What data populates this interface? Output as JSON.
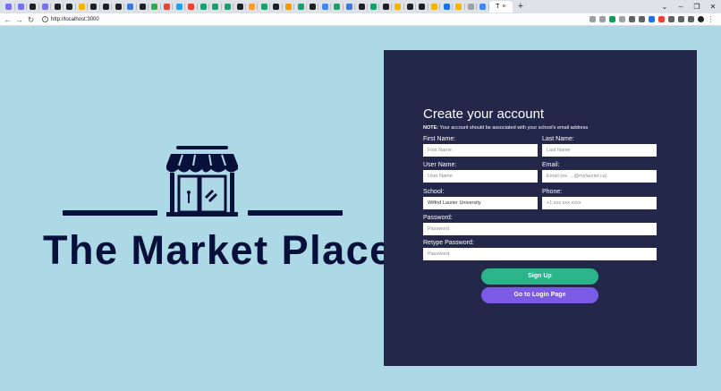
{
  "browser": {
    "tab_favicon_colors": [
      "#7a6ff0",
      "#7a6ff0",
      "#202124",
      "#7a6ff0",
      "#202124",
      "#202124",
      "#f5b400",
      "#202124",
      "#202124",
      "#202124",
      "#3c78d8",
      "#202124",
      "#34a853",
      "#ea4335",
      "#1da1f2",
      "#ea4335",
      "#1a9e6e",
      "#1a9e6e",
      "#1a9e6e",
      "#202124",
      "#f0a030",
      "#1a9e6e",
      "#202124",
      "#f29900",
      "#1a9e6e",
      "#202124",
      "#4285f4",
      "#1a9e6e",
      "#3c78d8",
      "#202124",
      "#1a9e6e",
      "#202124",
      "#f4b400",
      "#202124",
      "#202124",
      "#f4b400",
      "#1a73e8",
      "#f4b400",
      "#9aa0a6",
      "#4285f4"
    ],
    "active_tab_label": "T",
    "tab_close": "×",
    "new_tab": "+",
    "url": "http://localhost:3000",
    "ext_colors": [
      "#9aa0a6",
      "#9aa0a6",
      "#0f9d58",
      "#9aa0a6",
      "#5f6368",
      "#5f6368",
      "#1a73e8",
      "#ea4335",
      "#5f6368",
      "#5f6368",
      "#5f6368",
      "#202124"
    ]
  },
  "brand": {
    "title": "The Market Place",
    "color": "#06103a"
  },
  "form": {
    "title": "Create your account",
    "note_label": "NOTE:",
    "note_text": " Your account should be associated with your school's email address",
    "first_name_label": "First Name:",
    "first_name_placeholder": "First Name",
    "last_name_label": "Last Name:",
    "last_name_placeholder": "Last Name",
    "username_label": "User Name:",
    "username_placeholder": "User Name",
    "email_label": "Email:",
    "email_placeholder": "Email (ex. ...@mylaurier.ca)",
    "school_label": "School:",
    "school_value": "Wilfrid Laurier University",
    "phone_label": "Phone:",
    "phone_placeholder": "+1 xxx xxx xxxx",
    "password_label": "Password:",
    "password_placeholder": "Password",
    "retype_label": "Retype Password:",
    "retype_placeholder": "Password",
    "signup_label": "Sign Up",
    "login_label": "Go to Login Page"
  },
  "colors": {
    "background": "#add8e6",
    "panel": "#23274a",
    "signup": "#2bb38a",
    "login": "#7b5be6"
  }
}
